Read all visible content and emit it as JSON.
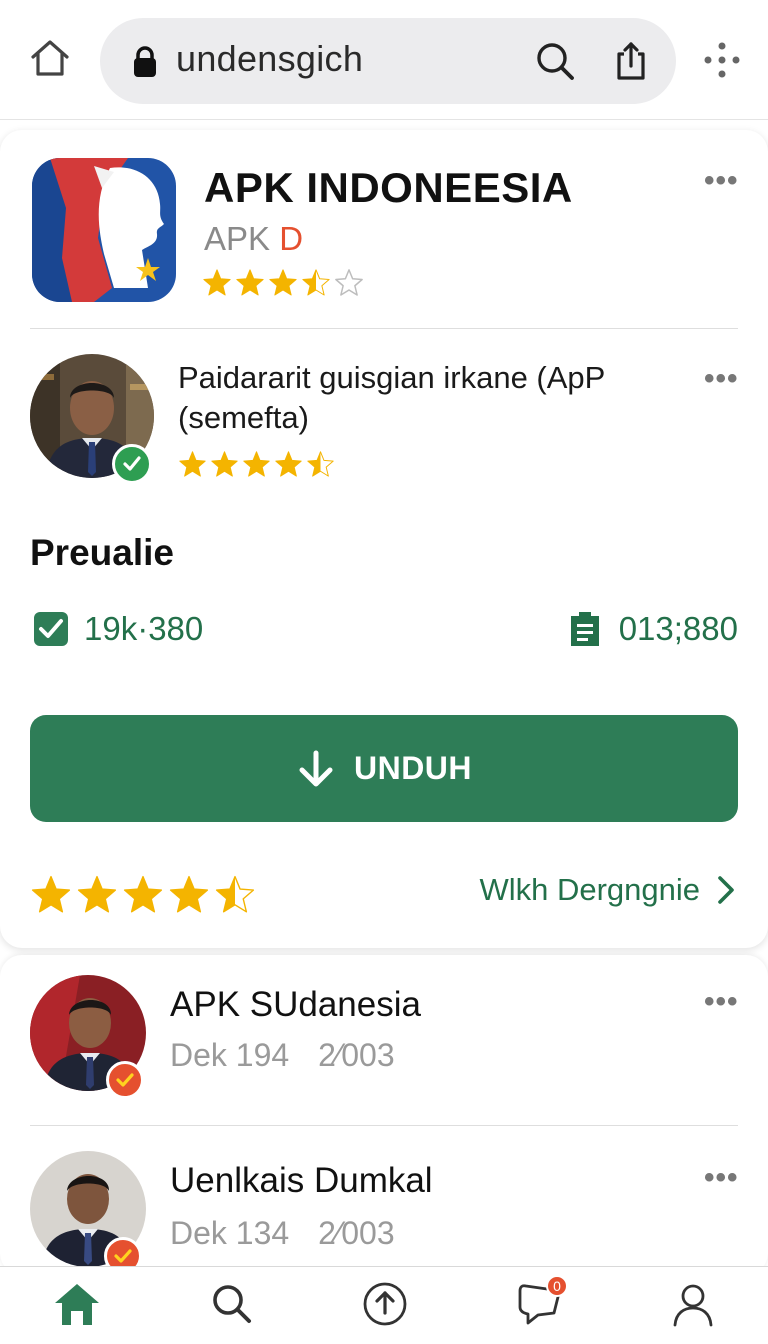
{
  "browser": {
    "url": "undensgich"
  },
  "app": {
    "title": "APK INDONEESIA",
    "subtitle_prefix": "APK",
    "subtitle_accent": "D",
    "rating": 3.5,
    "menu": "•••"
  },
  "developer": {
    "line1": "Paidararit guisgian irkane (ApP",
    "line2": "(semefta)",
    "rating": 4.5,
    "verified": true,
    "menu": "•••"
  },
  "preview": {
    "section_title": "Preualie",
    "stat_left": "19k·380",
    "stat_right": "013;880"
  },
  "download": {
    "label": "UNDUH"
  },
  "rating_row": {
    "rating": 4.5,
    "see_more": "Wlkh Dergngnie"
  },
  "list": [
    {
      "title": "APK SUdanesia",
      "meta_left": "Dek 194",
      "meta_right": "2⁄003",
      "menu": "•••"
    },
    {
      "title": "Uenlkais Dumkal",
      "meta_left": "Dek 134",
      "meta_right": "2⁄003",
      "menu": "•••"
    }
  ],
  "bottom_nav": [
    {
      "icon": "home-icon",
      "active": true
    },
    {
      "icon": "search-icon"
    },
    {
      "icon": "upload-icon"
    },
    {
      "icon": "chat-icon",
      "badge": "0"
    },
    {
      "icon": "profile-icon"
    }
  ],
  "colors": {
    "accent_green": "#2e7d57",
    "star_gold": "#f4b400",
    "badge_orange": "#e5502f"
  }
}
